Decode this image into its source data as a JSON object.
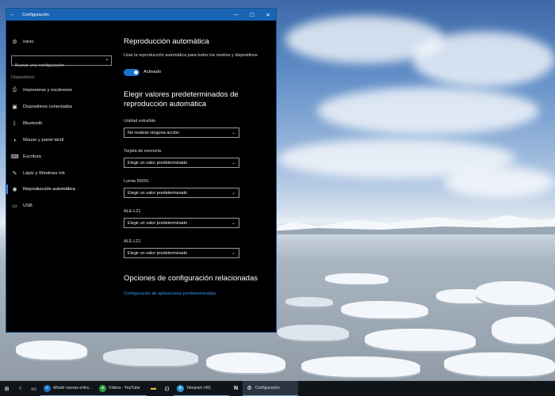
{
  "window": {
    "title": "Configuración",
    "back_icon": "back-arrow-icon",
    "minimize_icon": "minimize-icon",
    "maximize_icon": "maximize-icon",
    "close_icon": "close-icon"
  },
  "sidebar": {
    "home_label": "Inicio",
    "search_placeholder": "Buscar una configuración",
    "section_label": "Dispositivos",
    "items": [
      {
        "label": "Impresoras y escáneres",
        "icon": "printer-icon"
      },
      {
        "label": "Dispositivos conectados",
        "icon": "devices-icon"
      },
      {
        "label": "Bluetooth",
        "icon": "bluetooth-icon"
      },
      {
        "label": "Mouse y panel táctil",
        "icon": "mouse-icon"
      },
      {
        "label": "Escritura",
        "icon": "keyboard-icon"
      },
      {
        "label": "Lápiz y Windows Ink",
        "icon": "pen-icon"
      },
      {
        "label": "Reproducción automática",
        "icon": "autoplay-icon"
      },
      {
        "label": "USB",
        "icon": "usb-icon"
      }
    ],
    "active_index": 6
  },
  "main": {
    "autoplay_title": "Reproducción automática",
    "autoplay_desc": "Usar la reproducción automática para todos los medios y dispositivos",
    "toggle_state": "Activado",
    "defaults_title": "Elegir valores predeterminados de reproducción automática",
    "fields": [
      {
        "label": "Unidad extraíble",
        "value": "No realizar ninguna acción"
      },
      {
        "label": "Tarjeta de memoria",
        "value": "Elegir un valor predeterminado"
      },
      {
        "label": "Lumia 950XL",
        "value": "Elegir un valor predeterminado"
      },
      {
        "label": "ALE-L21",
        "value": "Elegir un valor predeterminado"
      },
      {
        "label": "ALE-L21",
        "value": "Elegir un valor predeterminado"
      }
    ],
    "related_title": "Opciones de configuración relacionadas",
    "related_link": "Configuración de aplicaciones predeterminadas"
  },
  "taskbar": {
    "apps": [
      {
        "label": "Añadir nuevas entra...",
        "icon": "edge-icon",
        "color": "#1a73c8"
      },
      {
        "label": "Vídeos - YouTube",
        "icon": "chrome-icon",
        "color": "#2e9e4a"
      },
      {
        "label": "Telegram (40)",
        "icon": "telegram-icon",
        "color": "#2a9fd8"
      },
      {
        "label": "Configuración",
        "icon": "gear-icon",
        "color": "#555555"
      }
    ]
  }
}
